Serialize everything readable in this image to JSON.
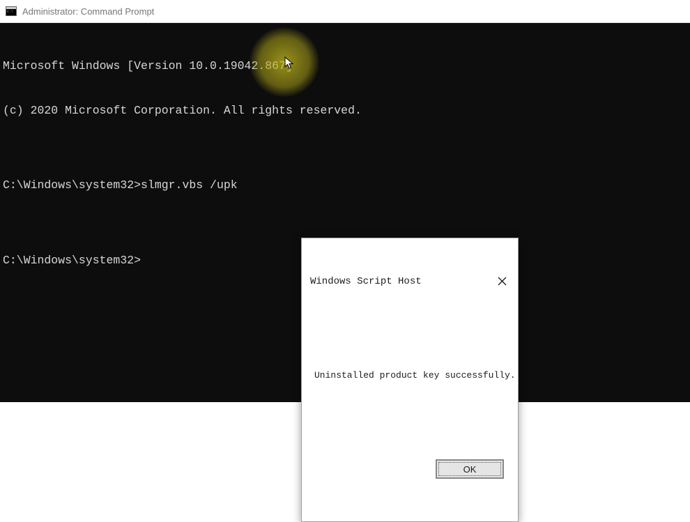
{
  "titlebar": {
    "title": "Administrator: Command Prompt"
  },
  "terminal": {
    "line1": "Microsoft Windows [Version 10.0.19042.867]",
    "line2": "(c) 2020 Microsoft Corporation. All rights reserved.",
    "blank1": "",
    "line3": "C:\\Windows\\system32>slmgr.vbs /upk",
    "blank2": "",
    "line4": "C:\\Windows\\system32>"
  },
  "dialog": {
    "title": "Windows Script Host",
    "message": "Uninstalled product key successfully.",
    "ok_label": "OK"
  }
}
